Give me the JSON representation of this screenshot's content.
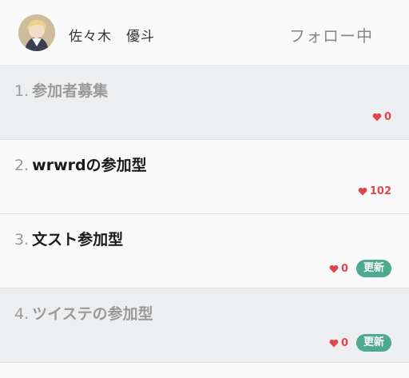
{
  "user": {
    "name": "佐々木　優斗"
  },
  "follow_label": "フォロー中",
  "items": [
    {
      "num": "1.",
      "title": "参加者募集",
      "likes": "0",
      "badge": "",
      "read": true
    },
    {
      "num": "2.",
      "title": "wrwrdの参加型",
      "likes": "102",
      "badge": "",
      "read": false
    },
    {
      "num": "3.",
      "title": "文スト参加型",
      "likes": "0",
      "badge": "更新",
      "read": false
    },
    {
      "num": "4.",
      "title": "ツイステの参加型",
      "likes": "0",
      "badge": "更新",
      "read": true
    }
  ],
  "colors": {
    "heart": "#e0474c",
    "badge": "#4fa98f",
    "read_bg": "#edeef0"
  }
}
